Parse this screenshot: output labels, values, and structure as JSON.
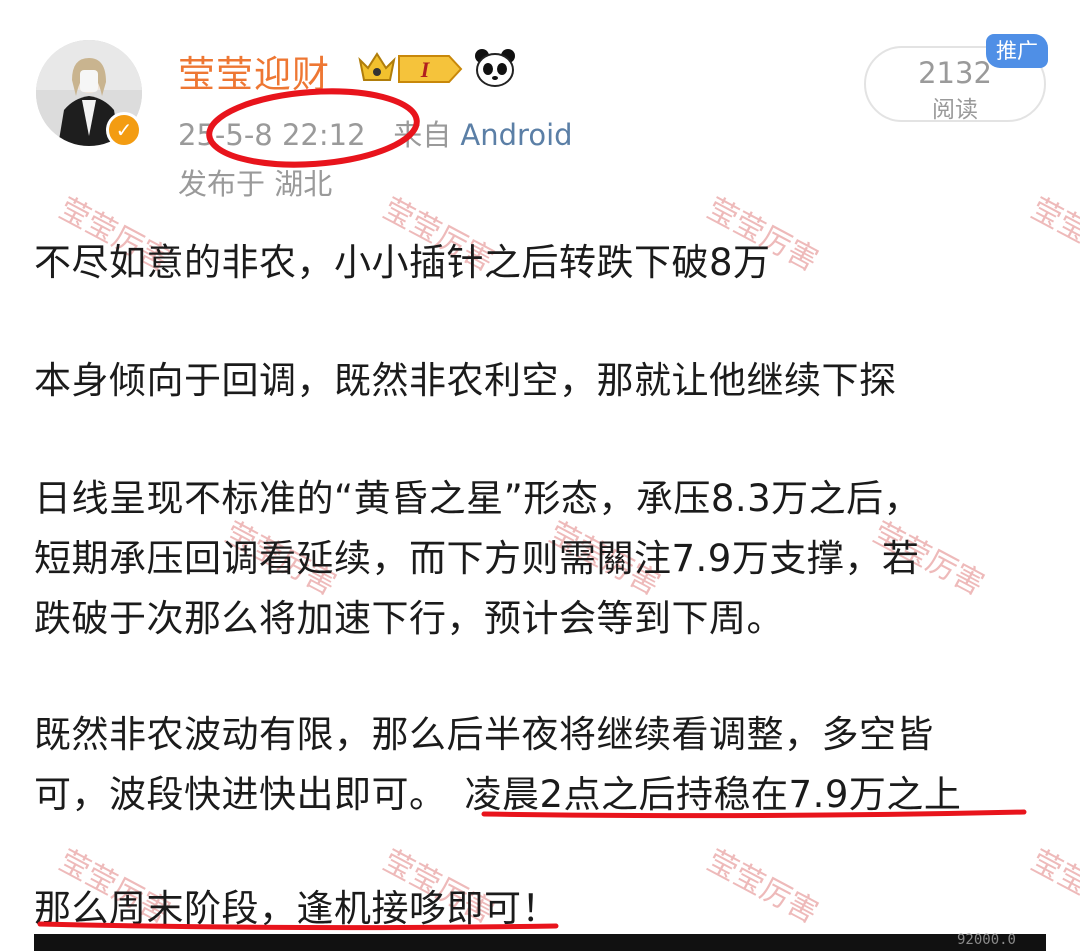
{
  "post": {
    "author": "莹莹迎财",
    "level_badge": "I",
    "timestamp": "25-5-8 22:12",
    "via_prefix": "来自",
    "via_source": "Android",
    "location": "发布于 湖北",
    "reads": "2132",
    "reads_label": "阅读",
    "ad_tag": "推广",
    "lines": [
      "不尽如意的非农，小小插针之后转跌下破8万",
      "本身倾向于回调，既然非农利空，那就让他继续下探",
      "日线呈现不标准的“黄昏之星”形态，承压8.3万之后，",
      "短期承压回调看延续，而下方则需關注7.9万支撑，若",
      "跌破于次那么将加速下行，预计会等到下周。",
      "既然非农波动有限，那么后半夜将继续看调整，多空皆",
      "可，波段快进快出即可。",
      "凌晨2点之后持稳在7.9万之上",
      "那么周末阶段，逢机接哆即可！"
    ]
  },
  "watermark": "莹莹厉害",
  "bottom_value": "92000.0",
  "colors": {
    "username": "#ee7733",
    "link": "#5b7fa6",
    "annotation_red": "#e8141c",
    "ad_blue": "#4f8fe6",
    "verified": "#f39c12"
  },
  "icons": [
    "verified-icon",
    "crown-icon",
    "level-badge-icon",
    "panda-icon"
  ]
}
